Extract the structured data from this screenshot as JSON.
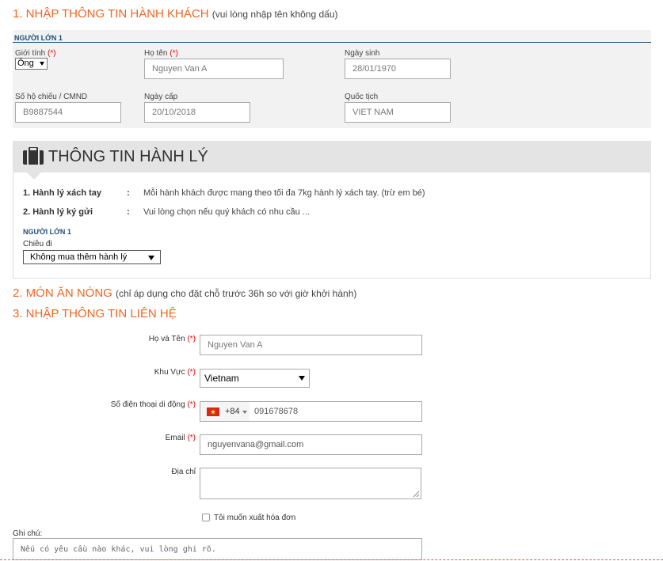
{
  "section1": {
    "number_title": "1. NHẬP THÔNG TIN HÀNH KHÁCH",
    "subtitle": "(vui lòng nhập tên không dấu)",
    "pax_heading": "NGƯỜI LỚN 1",
    "gender": {
      "label": "Giới tính",
      "req": "(*)",
      "value": "Ông"
    },
    "fullname": {
      "label": "Họ tên",
      "req": "(*)",
      "value": "Nguyen Van A"
    },
    "dob": {
      "label": "Ngày sinh",
      "value": "28/01/1970"
    },
    "passport": {
      "label": "Số hộ chiếu / CMND",
      "value": "B9887544"
    },
    "issue_date": {
      "label": "Ngày cấp",
      "value": "20/10/2018"
    },
    "nationality": {
      "label": "Quốc tịch",
      "value": "VIET NAM"
    }
  },
  "baggage": {
    "title": "THÔNG TIN HÀNH LÝ",
    "rows": [
      {
        "key": "1. Hành lý xách tay",
        "colon": ":",
        "value": "Mỗi hành khách được mang theo tối đa 7kg hành lý xách tay. (trừ em bé)"
      },
      {
        "key": "2. Hành lý ký gửi",
        "colon": ":",
        "value": "Vui lòng chọn nếu quý khách có nhu cầu ..."
      }
    ],
    "pax_heading": "NGƯỜI LỚN 1",
    "direction_label": "Chiều đi",
    "select_value": "Không mua thêm hành lý"
  },
  "section2": {
    "number_title": "2. MÓN ĂN NÓNG",
    "subtitle": "(chỉ áp dụng cho đặt chỗ trước 36h so với giờ khởi hành)"
  },
  "section3": {
    "number_title": "3. NHẬP THÔNG TIN LIÊN HỆ",
    "name": {
      "label": "Họ và Tên",
      "req": "(*)",
      "value": "Nguyen Van A"
    },
    "region": {
      "label": "Khu Vực",
      "req": "(*)",
      "value": "Vietnam"
    },
    "phone": {
      "label": "Số điện thoại di động",
      "req": "(*)",
      "dial_code": "+84",
      "value": "091678678"
    },
    "email": {
      "label": "Email",
      "req": "(*)",
      "value": "nguyenvana@gmail.com"
    },
    "address": {
      "label": "Địa chỉ",
      "value": ""
    },
    "invoice_label": "Tôi muốn xuất hóa đơn",
    "note": {
      "label": "Ghi chú:",
      "placeholder": "Nếu có yêu cầu nào khác, vui lòng ghi rõ."
    }
  },
  "colors": {
    "accent": "#f26522",
    "heading_blue": "#1f4e79",
    "required": "#e00000"
  },
  "icons": {
    "baggage": "suitcase-icon",
    "flag": "vietnam-flag-icon"
  }
}
